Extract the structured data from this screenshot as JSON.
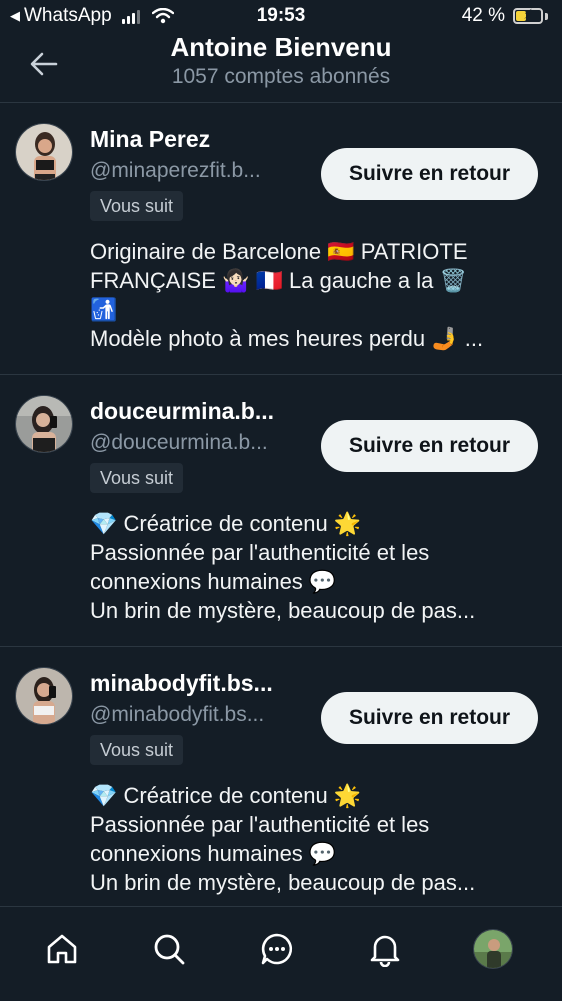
{
  "status_bar": {
    "back_app": "WhatsApp",
    "time": "19:53",
    "battery": "42 %",
    "battery_level": 0.42
  },
  "header": {
    "title": "Antoine Bienvenu",
    "subtitle": "1057 comptes abonnés"
  },
  "followers": [
    {
      "name": "Mina Perez",
      "handle": "@minaperezfit.b...",
      "badge": "Vous suit",
      "button": "Suivre en retour",
      "bio": [
        "Originaire de Barcelone 🇪🇸 PATRIOTE",
        "FRANÇAISE 🤷🏻‍♀️ 🇫🇷 La gauche a la 🗑️",
        "🚮",
        "Modèle photo à mes heures perdu 🤳 ..."
      ]
    },
    {
      "name": "douceurmina.b...",
      "handle": "@douceurmina.b...",
      "badge": "Vous suit",
      "button": "Suivre en retour",
      "bio": [
        "💎 Créatrice de contenu 🌟",
        "Passionnée par l'authenticité et les",
        "connexions humaines 💬",
        "Un brin de mystère, beaucoup de pas..."
      ]
    },
    {
      "name": "minabodyfit.bs...",
      "handle": "@minabodyfit.bs...",
      "badge": "Vous suit",
      "button": "Suivre en retour",
      "bio": [
        "💎 Créatrice de contenu 🌟",
        "Passionnée par l'authenticité et les",
        "connexions humaines 💬",
        "Un brin de mystère, beaucoup de pas..."
      ]
    }
  ],
  "bottom_nav": [
    "home-icon",
    "search-icon",
    "messages-icon",
    "notifications-icon",
    "profile-avatar"
  ],
  "colors": {
    "background": "#141d26",
    "text_secondary": "#8b98a5",
    "button_bg": "#eff3f4",
    "divider": "#2b3640",
    "battery": "#f5d33a"
  }
}
